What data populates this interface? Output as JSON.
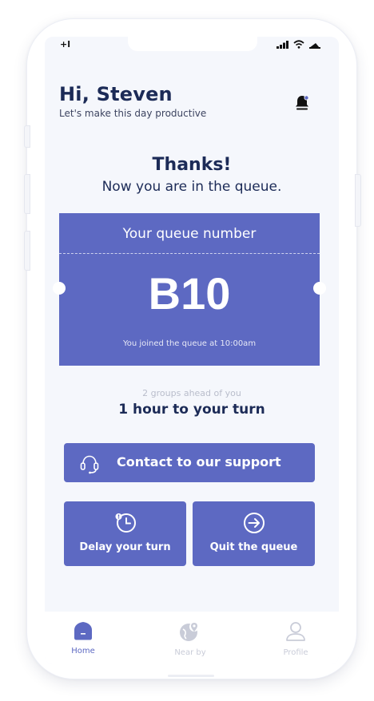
{
  "status_bar": {
    "carrier": "+l"
  },
  "header": {
    "greeting": "Hi, Steven",
    "subtitle": "Let's make this day productive"
  },
  "confirmation": {
    "title": "Thanks!",
    "subtitle": "Now you are in the queue."
  },
  "ticket": {
    "label": "Your queue number",
    "number": "B10",
    "joined_text": "You joined the queue at 10:00am"
  },
  "wait": {
    "ahead_text": "2 groups ahead of you",
    "eta_text": "1 hour to your turn"
  },
  "actions": {
    "support_label": "Contact to our support",
    "delay_label": "Delay your turn",
    "quit_label": "Quit the queue"
  },
  "tabs": [
    {
      "label": "Home",
      "icon": "home-icon",
      "active": true
    },
    {
      "label": "Near by",
      "icon": "map-pin-icon",
      "active": false
    },
    {
      "label": "Profile",
      "icon": "user-icon",
      "active": false
    }
  ],
  "colors": {
    "accent": "#5d69c2",
    "navy": "#1c2b57",
    "screen_bg": "#f5f7fc",
    "inactive_tab": "#c9ccd8"
  }
}
